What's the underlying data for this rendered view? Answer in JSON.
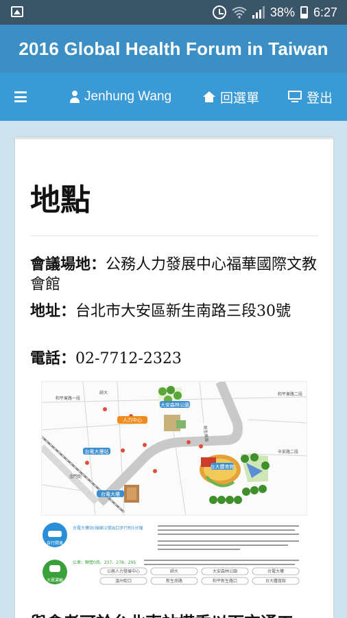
{
  "status_bar": {
    "battery": "38%",
    "time": "6:27"
  },
  "header": {
    "title": "2016 Global Health Forum in Taiwan"
  },
  "nav": {
    "user_name": "Jenhung Wang",
    "home_label": "回選單",
    "logout_label": "登出"
  },
  "content": {
    "page_title": "地點",
    "venue_label": "會議場地：",
    "venue_value": "公務人力發展中心福華國際文教會館",
    "address_label": "地址：",
    "address_value": "台北市大安區新生南路三段30號",
    "phone_label": "電話：",
    "phone_value": "02-7712-2323",
    "bottom_heading": "與會者可於台北東站搭乘以下交通工"
  },
  "map": {
    "labels": {
      "mrt_daan": "大安森林公園",
      "hotel": "人力中心",
      "station1": "台電大樓站",
      "station2": "台電大樓",
      "park": "台大體育館",
      "road_top": "和平東路一段",
      "road_right": "和平東路二段",
      "road_right2": "辛亥路二段",
      "road_left": "新生南路",
      "school": "師大",
      "lane": "金門街"
    }
  },
  "legend": {
    "walk_label": "自行開車",
    "mrt_label": "大眾運輸",
    "line1": "台電大樓站(綠線)2號出口步行約5分鐘",
    "line2": "公車：聯營0南、237、278、295",
    "stops": [
      "公務人力發展中心",
      "師大",
      "大安森林公園",
      "台電大樓",
      "溫州街口",
      "新生南路",
      "和平新生路口",
      "台大體育館"
    ]
  }
}
